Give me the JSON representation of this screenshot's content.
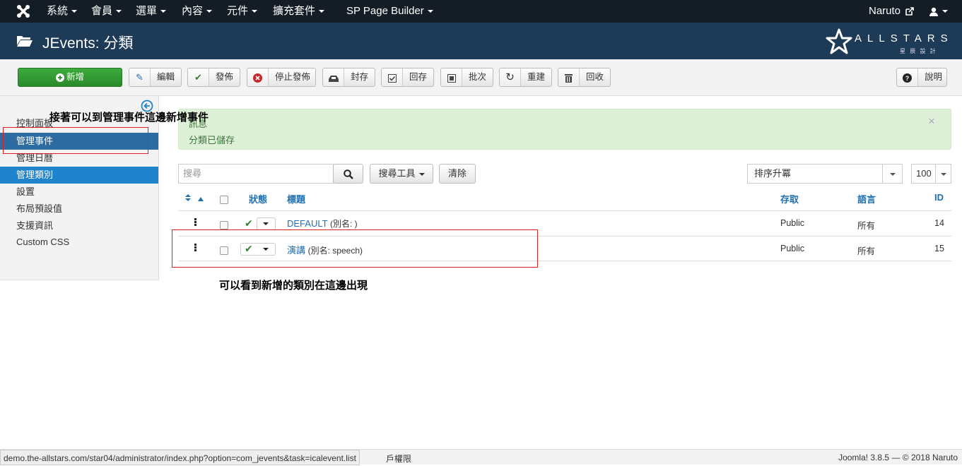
{
  "topnav": {
    "menus": [
      "系統",
      "會員",
      "選單",
      "內容",
      "元件",
      "擴充套件",
      "SP Page Builder"
    ],
    "user_name": "Naruto"
  },
  "header": {
    "title": "JEvents: 分類",
    "brand": "ALLSTARS",
    "brand_sub": "星 辰 設 計"
  },
  "toolbar": {
    "new": "新增",
    "edit": "編輯",
    "publish": "發佈",
    "unpublish": "停止發佈",
    "archive": "封存",
    "checkin": "回存",
    "batch": "批次",
    "rebuild": "重建",
    "trash": "回收",
    "help": "說明"
  },
  "sidebar": {
    "items": [
      "控制面板",
      "管理事件",
      "管理日曆",
      "管理類別",
      "設置",
      "布局預設值",
      "支援資訊",
      "Custom CSS"
    ]
  },
  "alert": {
    "heading": "訊息",
    "message": "分類已儲存"
  },
  "filters": {
    "search_placeholder": "搜尋",
    "search_tools": "搜尋工具",
    "clear": "清除",
    "ordering": "排序升冪",
    "limit": "100"
  },
  "table": {
    "headers": {
      "status": "狀態",
      "title": "標題",
      "access": "存取",
      "language": "語言",
      "id": "ID"
    },
    "rows": [
      {
        "title": "DEFAULT",
        "alias": "(別名: )",
        "access": "Public",
        "language": "所有",
        "id": "14"
      },
      {
        "title": "演講",
        "alias": "(別名: speech)",
        "access": "Public",
        "language": "所有",
        "id": "15"
      }
    ]
  },
  "annotations": {
    "note1": "接著可以到管理事件這邊新增事件",
    "note2": "可以看到新增的類別在這邊出現"
  },
  "statusbar": {
    "url": "demo.the-allstars.com/star04/administrator/index.php?option=com_jevents&task=icalevent.list",
    "perm": "戶權限",
    "version": "Joomla! 3.8.5 — © 2018 Naruto"
  },
  "colors": {
    "nav": "#141c25",
    "header": "#1d3b57",
    "accent": "#1f6fb2",
    "success": "#dff0d8",
    "annotation": "#e02020"
  }
}
